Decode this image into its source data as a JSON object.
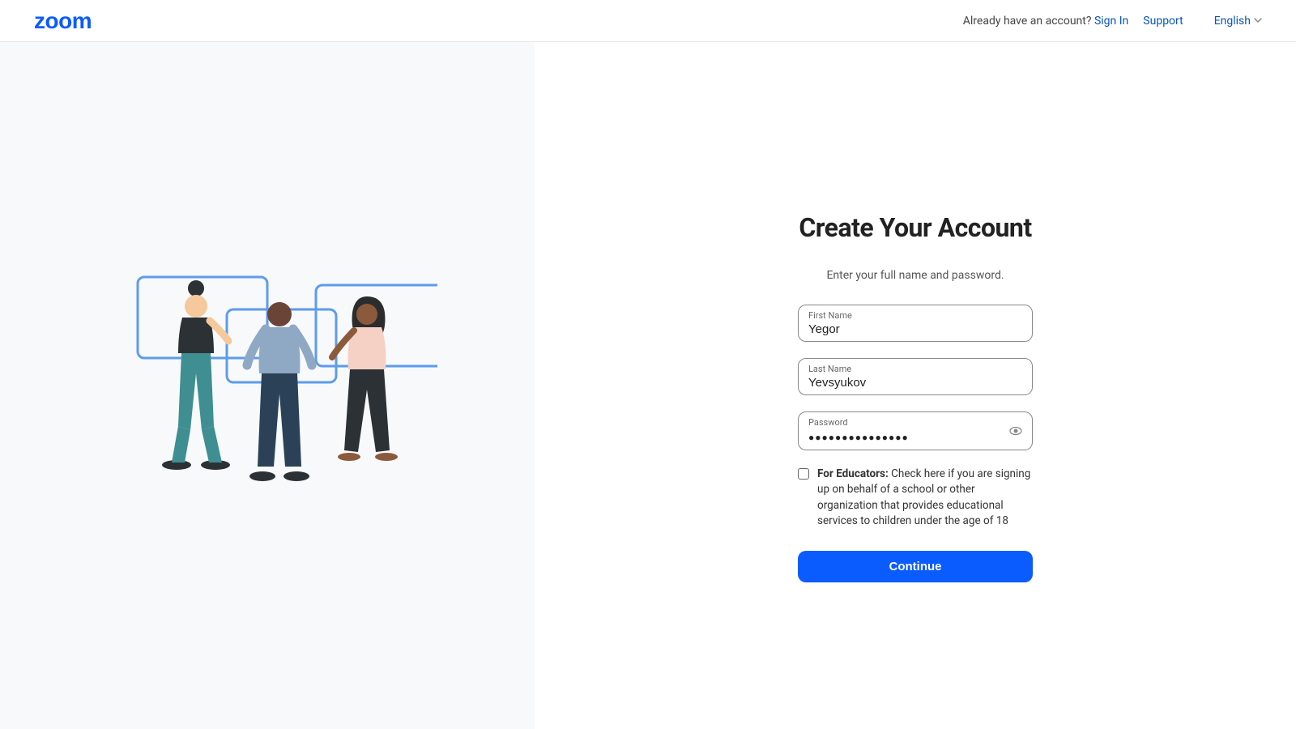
{
  "header": {
    "logo": "zoom",
    "already_text": "Already have an account?",
    "sign_in": "Sign In",
    "support": "Support",
    "language": "English"
  },
  "form": {
    "title": "Create Your Account",
    "subtitle": "Enter your full name and password.",
    "first_name_label": "First Name",
    "first_name_value": "Yegor",
    "last_name_label": "Last Name",
    "last_name_value": "Yevsyukov",
    "password_label": "Password",
    "password_value": "●●●●●●●●●●●●●●●",
    "educators_strong": "For Educators:",
    "educators_text": " Check here if you are signing up on behalf of a school or other organization that provides educational services to children under the age of 18",
    "continue": "Continue"
  }
}
